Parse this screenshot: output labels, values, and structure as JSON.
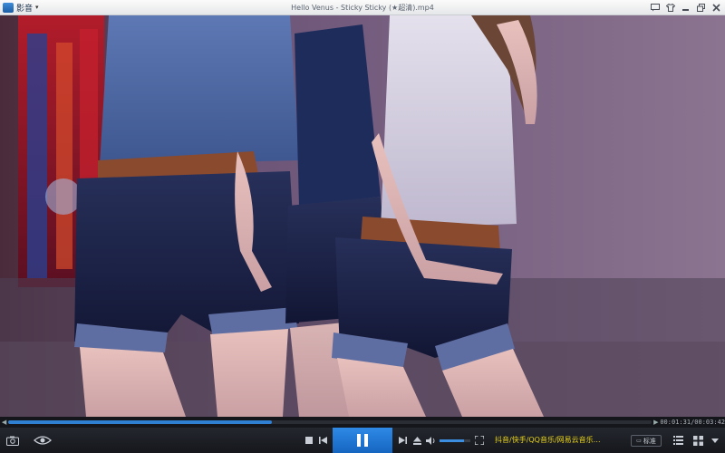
{
  "app": {
    "name": "影音",
    "window_title": "Hello Venus - Sticky Sticky (★超清).mp4"
  },
  "playback": {
    "current_time": "00:01:31",
    "duration": "00:03:42",
    "progress_fraction": 0.41,
    "volume_fraction": 0.8,
    "state": "playing"
  },
  "controls": {
    "quality_label": "标准",
    "ticker_text": "抖音/快手/QQ音乐/网易云音乐…"
  },
  "icons": {
    "app_logo": "app-logo-icon",
    "menu_chevron": "chevron-down-icon",
    "feedback": "message-icon",
    "skin": "shirt-icon",
    "minimize": "minimize-icon",
    "restore": "restore-icon",
    "close": "close-icon",
    "screenshot": "camera-icon",
    "eye": "eye-icon",
    "stop": "stop-icon",
    "prev": "previous-icon",
    "pause": "pause-icon",
    "next": "next-icon",
    "eject": "eject-icon",
    "volume": "volume-icon",
    "fullscreen": "fullscreen-icon",
    "playlist": "playlist-icon",
    "toolbox": "toolbox-icon"
  },
  "colors": {
    "accent": "#2f7fd2",
    "ticker": "#e8d21a",
    "control_bg": "#1a1c21"
  }
}
